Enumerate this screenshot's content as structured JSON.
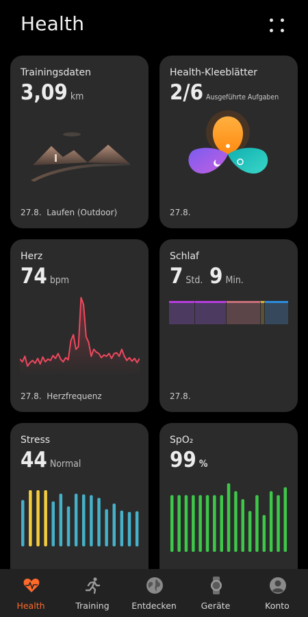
{
  "header": {
    "title": "Health"
  },
  "cards": {
    "training": {
      "label": "Trainingsdaten",
      "value": "3,09",
      "unit": "km",
      "date": "27.8.",
      "activity": "Laufen (Outdoor)"
    },
    "clover": {
      "label": "Health-Kleeblätter",
      "value": "2/6",
      "unit": "Ausgeführte Aufgaben",
      "date": "27.8."
    },
    "heart": {
      "label": "Herz",
      "value": "74",
      "unit": "bpm",
      "date": "27.8.",
      "caption": "Herzfrequenz",
      "series": [
        62,
        58,
        66,
        52,
        57,
        60,
        56,
        63,
        55,
        65,
        58,
        62,
        60,
        67,
        63,
        70,
        62,
        58,
        64,
        61,
        88,
        97,
        76,
        80,
        150,
        140,
        94,
        86,
        66,
        76,
        72,
        70,
        64,
        68,
        66,
        70,
        63,
        70,
        71,
        66,
        76,
        66,
        60,
        64,
        59,
        63,
        57,
        63
      ]
    },
    "sleep": {
      "label": "Schlaf",
      "hours": "7",
      "hours_unit": "Std.",
      "minutes": "9",
      "minutes_unit": "Min.",
      "date": "27.8.",
      "segments": [
        {
          "weight": 22,
          "top": "#b93de0",
          "fill": "#4c3a60"
        },
        {
          "weight": 27,
          "top": "#b93de0",
          "fill": "#4c3a60"
        },
        {
          "weight": 29,
          "top": "#c9707a",
          "fill": "#5b4548"
        },
        {
          "weight": 3,
          "top": "#d6b13b",
          "fill": "#5a5034"
        },
        {
          "weight": 20,
          "top": "#2d8de0",
          "fill": "#35485c"
        }
      ]
    },
    "stress": {
      "label": "Stress",
      "value": "44",
      "status": "Normal",
      "bars": [
        66,
        80,
        80,
        80,
        64,
        75,
        57,
        75,
        74,
        73,
        69,
        53,
        61,
        51,
        49,
        50
      ],
      "colors": [
        "#46b1c9",
        "#f4cd3c",
        "#f4cd3c",
        "#f4cd3c",
        "#46b1c9",
        "#46b1c9",
        "#46b1c9",
        "#46b1c9",
        "#46b1c9",
        "#46b1c9",
        "#46b1c9",
        "#46b1c9",
        "#46b1c9",
        "#46b1c9",
        "#46b1c9",
        "#46b1c9"
      ]
    },
    "spo2": {
      "label": "SpO₂",
      "value": "99",
      "unit": "%",
      "bars": [
        94,
        94,
        94,
        94,
        94,
        94,
        94,
        94,
        97,
        95,
        93,
        90,
        94,
        89,
        95,
        94,
        96
      ],
      "color": "#3ec84a"
    }
  },
  "nav": {
    "items": [
      {
        "label": "Health",
        "icon": "heart-pulse-icon"
      },
      {
        "label": "Training",
        "icon": "runner-icon"
      },
      {
        "label": "Entdecken",
        "icon": "globe-icon"
      },
      {
        "label": "Geräte",
        "icon": "watch-icon"
      },
      {
        "label": "Konto",
        "icon": "profile-icon"
      }
    ],
    "active_color": "#ff6a2b"
  }
}
